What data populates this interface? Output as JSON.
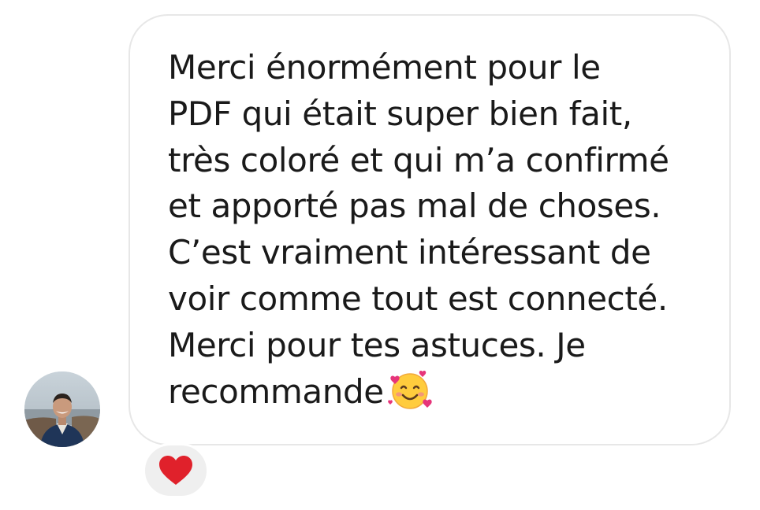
{
  "message": {
    "lines": [
      "Merci énormément pour le",
      "PDF qui était super bien fait,",
      "très coloré et qui m’a confirmé",
      "et apporté pas mal de choses.",
      "C’est vraiment intéressant de",
      "voir comme tout est connecté.",
      "Merci pour tes astuces. Je",
      "recommande"
    ],
    "trailing_emoji": "smiling-face-with-hearts-icon"
  },
  "reaction": {
    "icon": "red-heart-icon",
    "color": "#e0212b"
  },
  "avatar": {
    "icon": "user-avatar-photo"
  },
  "colors": {
    "bubble_border": "#e7e7e7",
    "reaction_background": "#efefef",
    "text": "#1a1a1a"
  }
}
